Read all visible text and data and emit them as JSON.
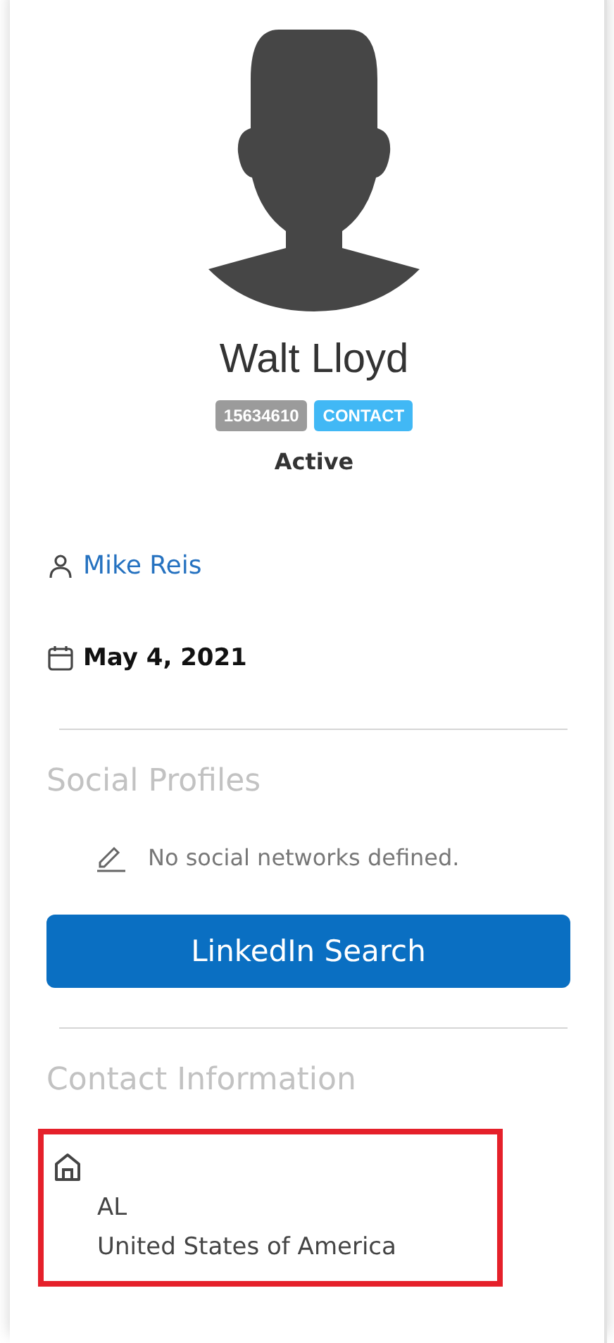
{
  "profile": {
    "name": "Walt Lloyd",
    "id_badge": "15634610",
    "type_badge": "CONTACT",
    "status": "Active"
  },
  "owner": {
    "name": "Mike Reis"
  },
  "date": "May 4, 2021",
  "social_profiles": {
    "heading": "Social Profiles",
    "empty_message": "No social networks defined.",
    "button": "LinkedIn Search"
  },
  "contact_information": {
    "heading": "Contact Information",
    "address": {
      "highlighted": true,
      "lines": [
        "AL",
        "United States of America"
      ]
    }
  }
}
